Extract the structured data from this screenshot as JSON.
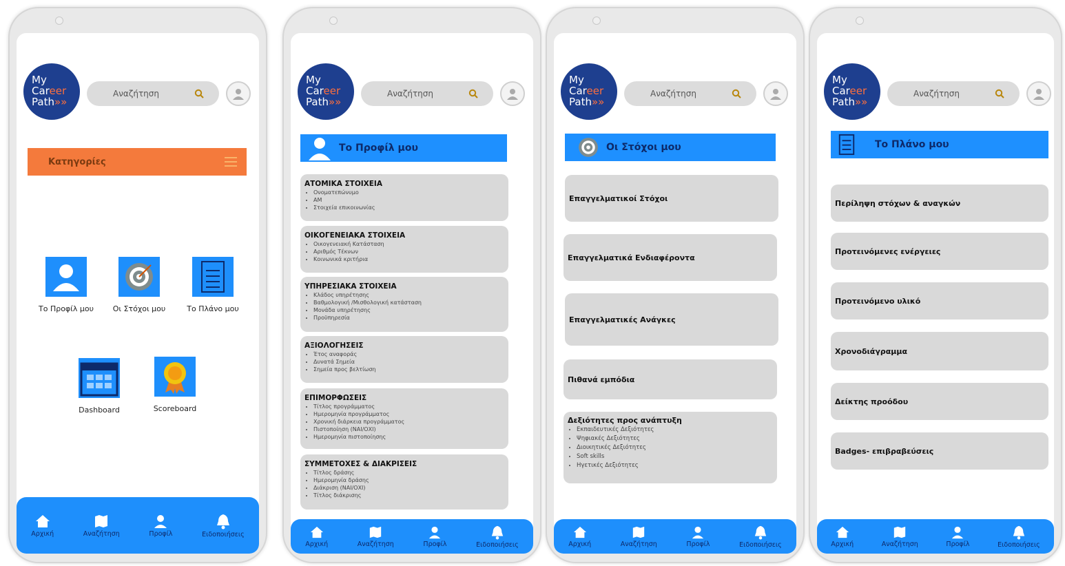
{
  "brand": {
    "line1": "My",
    "line2a": "Car",
    "line2b": "eer",
    "line3": "Path",
    "arrows": "»»"
  },
  "search": {
    "placeholder": "Αναζήτηση"
  },
  "nav": [
    "Αρχική",
    "Αναζήτηση",
    "Προφίλ",
    "Ειδοποιήσεις"
  ],
  "home": {
    "categories_title": "Κατηγορίες",
    "tiles": [
      {
        "label": "Το Προφίλ μου"
      },
      {
        "label": "Οι Στόχοι μου"
      },
      {
        "label": "Το Πλάνο μου"
      },
      {
        "label": "Dashboard"
      },
      {
        "label": "Scoreboard"
      }
    ]
  },
  "profile": {
    "title": "Το Προφίλ μου",
    "sections": [
      {
        "heading": "ΑΤΟΜΙΚΑ ΣΤΟΙΧΕΙΑ",
        "items": [
          "Ονοματεπώνυμο",
          "ΑΜ",
          "Στοιχεία επικοινωνίας"
        ]
      },
      {
        "heading": "ΟΙΚΟΓΕΝΕΙΑΚΑ ΣΤΟΙΧΕΙΑ",
        "items": [
          "Οικογενειακή Κατάσταση",
          "Αριθμός Τέκνων",
          "Κοινωνικά κριτήρια"
        ]
      },
      {
        "heading": "ΥΠΗΡΕΣΙΑΚΑ ΣΤΟΙΧΕΙΑ",
        "items": [
          "Κλάδος υπηρέτησης",
          "Βαθμολογική /Μισθολογική κατάσταση",
          "Μονάδα υπηρέτησης",
          "Προϋπηρεσία"
        ]
      },
      {
        "heading": "ΑΞΙΟΛΟΓΗΣΕΙΣ",
        "items": [
          "Έτος αναφοράς",
          "Δυνατά Σημεία",
          "Σημεία προς βελτίωση"
        ]
      },
      {
        "heading": "ΕΠΙΜΟΡΦΩΣΕΙΣ",
        "items": [
          "Τίτλος προγράμματος",
          "Ημερομηνία προγράμματος",
          "Χρονική διάρκεια προγράμματος",
          "Πιστοποίηση (ΝΑΙ/ΟΧΙ)",
          "Ημερομηνία πιστοποίησης"
        ]
      },
      {
        "heading": "ΣΥΜΜΕΤΟΧΕΣ & ΔΙΑΚΡΙΣΕΙΣ",
        "items": [
          "Τίτλος δράσης",
          "Ημερομηνία δράσης",
          "Διάκριση (ΝΑΙ/ΟΧΙ)",
          "Τίτλος διάκρισης"
        ]
      }
    ]
  },
  "goals": {
    "title": "Οι Στόχοι μου",
    "cards": [
      "Επαγγελματικοί Στόχοι",
      "Επαγγελματικά Ενδιαφέροντα",
      "Επαγγελματικές Ανάγκες",
      "Πιθανά εμπόδια"
    ],
    "skills": {
      "heading": "Δεξιότητες προς ανάπτυξη",
      "items": [
        "Εκπαιδευτικές Δεξιότητες",
        "Ψηφιακές Δεξιότητες",
        "Διοικητικές Δεξιότητες",
        "Soft skills",
        "Ηγετικές Δεξιότητες"
      ]
    }
  },
  "plan": {
    "title": "Το Πλάνο μου",
    "cards": [
      "Περίληψη στόχων & αναγκών",
      "Προτεινόμενες ενέργειες",
      "Προτεινόμενο υλικό",
      "Χρονοδιάγραμμα",
      "Δείκτης προόδου",
      "Badges- επιβραβεύσεις"
    ]
  },
  "colors": {
    "primary": "#1e8ffc",
    "orange": "#f47a3c",
    "navy": "#1e3f8f",
    "card": "#d9d9d9"
  }
}
